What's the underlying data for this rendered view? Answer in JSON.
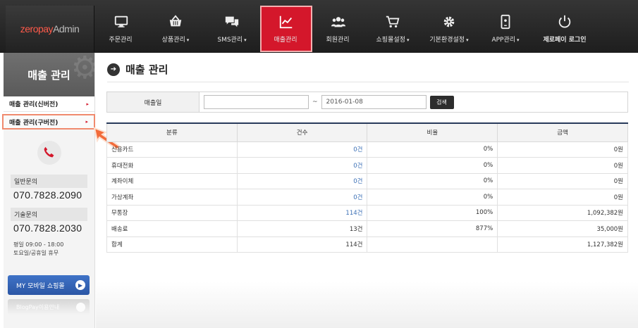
{
  "logo": {
    "brand": "zero",
    "brand2": "pay",
    "suffix": " Admin"
  },
  "nav": [
    {
      "label": "주문관리",
      "icon": "monitor-icon",
      "caret": ""
    },
    {
      "label": "상품관리",
      "icon": "basket-icon",
      "caret": "▾"
    },
    {
      "label": "SMS관리",
      "icon": "chat-icon",
      "caret": "▾"
    },
    {
      "label": "매출관리",
      "icon": "chart-icon",
      "caret": "",
      "active": true
    },
    {
      "label": "회원관리",
      "icon": "users-icon",
      "caret": ""
    },
    {
      "label": "쇼핑몰설정",
      "icon": "cart-icon",
      "caret": "▾"
    },
    {
      "label": "기본환경설정",
      "icon": "gear-icon",
      "caret": "▾"
    },
    {
      "label": "APP관리",
      "icon": "tablet-icon",
      "caret": "▾"
    },
    {
      "label": "제로페이 로그인",
      "icon": "power-icon",
      "caret": ""
    }
  ],
  "sidebar": {
    "title": "매출 관리",
    "items": [
      {
        "label": "매출 관리(신버전)",
        "arrow": "▸"
      },
      {
        "label": "매출 관리(구버전)",
        "arrow": "▸"
      }
    ],
    "contact1_label": "일반문의",
    "contact1_number": "070.7828.2090",
    "contact2_label": "기술문의",
    "contact2_number": "070.7828.2030",
    "hours1": "평일 09:00 - 18:00",
    "hours2": "토요일/공휴일 휴무",
    "mobile_button": "MY 모바일 쇼핑몰",
    "blog_button": "BlogPay이용안내"
  },
  "main": {
    "page_title": "매출 관리",
    "filter_label": "매출일",
    "date_from": "",
    "tilde": "~",
    "date_to": "2016-01-08",
    "search_button": "검색"
  },
  "table": {
    "headers": [
      "분류",
      "건수",
      "비율",
      "금액"
    ],
    "rows": [
      {
        "category": "신용카드",
        "count": "0건",
        "ratio": "0%",
        "amount": "0원",
        "link": true
      },
      {
        "category": "휴대전화",
        "count": "0건",
        "ratio": "0%",
        "amount": "0원",
        "link": true
      },
      {
        "category": "계좌이체",
        "count": "0건",
        "ratio": "0%",
        "amount": "0원",
        "link": true
      },
      {
        "category": "가상계좌",
        "count": "0건",
        "ratio": "0%",
        "amount": "0원",
        "link": true
      },
      {
        "category": "무통장",
        "count": "114건",
        "ratio": "100%",
        "amount": "1,092,382원",
        "link": true
      },
      {
        "category": "배송료",
        "count": "13건",
        "ratio": "877%",
        "amount": "35,000원",
        "link": false
      },
      {
        "category": "합계",
        "count": "114건",
        "ratio": "",
        "amount": "1,127,382원",
        "link": false
      }
    ]
  },
  "colors": {
    "accent": "#d4172b",
    "nav_bg": "#2a2a2a",
    "link": "#3a6fb5",
    "header_rule": "#273a5a"
  }
}
